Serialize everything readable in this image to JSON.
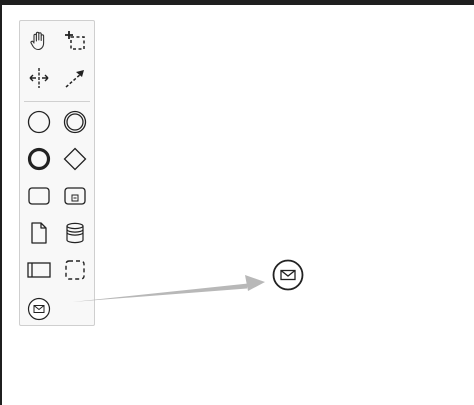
{
  "window": {
    "background": "#ffffff",
    "frame_color": "#1f1f1f"
  },
  "palette": {
    "tools": [
      {
        "id": "hand-tool",
        "icon": "hand-icon"
      },
      {
        "id": "lasso-tool",
        "icon": "lasso-icon"
      },
      {
        "id": "space-tool",
        "icon": "space-tool-icon"
      },
      {
        "id": "global-connect-tool",
        "icon": "connect-icon"
      },
      {
        "id": "start-event",
        "icon": "start-event-icon"
      },
      {
        "id": "intermediate-event",
        "icon": "intermediate-event-icon"
      },
      {
        "id": "end-event",
        "icon": "end-event-icon"
      },
      {
        "id": "gateway",
        "icon": "gateway-icon"
      },
      {
        "id": "task",
        "icon": "task-icon"
      },
      {
        "id": "subprocess",
        "icon": "subprocess-icon"
      },
      {
        "id": "data-object",
        "icon": "data-object-icon"
      },
      {
        "id": "data-store",
        "icon": "data-store-icon"
      },
      {
        "id": "pool",
        "icon": "pool-icon"
      },
      {
        "id": "group",
        "icon": "group-icon"
      },
      {
        "id": "message-event",
        "icon": "message-event-icon"
      }
    ]
  },
  "canvas": {
    "elements": [
      {
        "id": "message-event-element",
        "icon": "message-event-icon"
      }
    ],
    "annotation": {
      "type": "arrow",
      "color": "#b8b8b8"
    }
  }
}
